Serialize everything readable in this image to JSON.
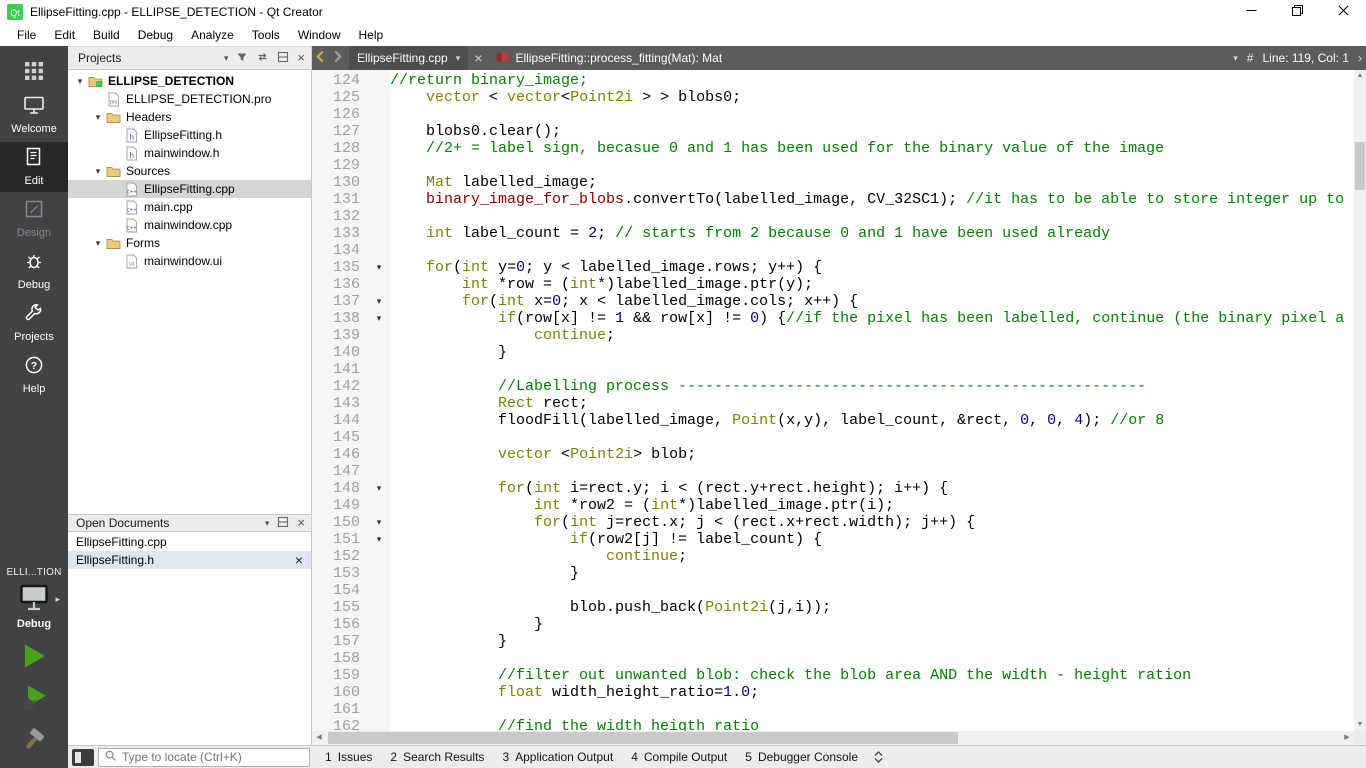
{
  "window": {
    "title": "EllipseFitting.cpp - ELLIPSE_DETECTION - Qt Creator"
  },
  "menu": {
    "items": [
      "File",
      "Edit",
      "Build",
      "Debug",
      "Analyze",
      "Tools",
      "Window",
      "Help"
    ]
  },
  "modes": {
    "items": [
      {
        "label": "Welcome",
        "icon": "welcome-icon",
        "state": "normal"
      },
      {
        "label": "Edit",
        "icon": "edit-icon",
        "state": "active"
      },
      {
        "label": "Design",
        "icon": "design-icon",
        "state": "disabled"
      },
      {
        "label": "Debug",
        "icon": "debug-icon",
        "state": "normal"
      },
      {
        "label": "Projects",
        "icon": "projects-icon",
        "state": "normal"
      },
      {
        "label": "Help",
        "icon": "help-icon",
        "state": "normal"
      }
    ],
    "kit": {
      "name": "ELLI...TION",
      "config": "Debug"
    }
  },
  "projects_panel": {
    "header": "Projects",
    "tree": [
      {
        "depth": 0,
        "expanded": true,
        "icon": "project",
        "label": "ELLIPSE_DETECTION",
        "bold": true
      },
      {
        "depth": 1,
        "icon": "pro",
        "label": "ELLIPSE_DETECTION.pro"
      },
      {
        "depth": 1,
        "expanded": true,
        "icon": "folder",
        "label": "Headers"
      },
      {
        "depth": 2,
        "icon": "h",
        "label": "EllipseFitting.h"
      },
      {
        "depth": 2,
        "icon": "h",
        "label": "mainwindow.h"
      },
      {
        "depth": 1,
        "expanded": true,
        "icon": "folder",
        "label": "Sources"
      },
      {
        "depth": 2,
        "icon": "cpp",
        "label": "EllipseFitting.cpp",
        "selected": true
      },
      {
        "depth": 2,
        "icon": "cpp",
        "label": "main.cpp"
      },
      {
        "depth": 2,
        "icon": "cpp",
        "label": "mainwindow.cpp"
      },
      {
        "depth": 1,
        "expanded": true,
        "icon": "folder",
        "label": "Forms"
      },
      {
        "depth": 2,
        "icon": "ui",
        "label": "mainwindow.ui"
      }
    ]
  },
  "open_documents": {
    "header": "Open Documents",
    "items": [
      {
        "label": "EllipseFitting.cpp",
        "selected": false,
        "closable": false
      },
      {
        "label": "EllipseFitting.h",
        "selected": true,
        "closable": true
      }
    ]
  },
  "editor": {
    "tab_label": "EllipseFitting.cpp",
    "symbol_label": "EllipseFitting::process_fitting(Mat): Mat",
    "hash_label": "#",
    "cursor_label": "Line: 119, Col: 1",
    "lines": [
      {
        "n": 124,
        "t": [
          [
            "cm",
            "//return binary_image;"
          ]
        ]
      },
      {
        "n": 125,
        "t": [
          [
            "pl",
            "    "
          ],
          [
            "kw",
            "vector"
          ],
          [
            "pl",
            " < "
          ],
          [
            "kw",
            "vector"
          ],
          [
            "pl",
            "<"
          ],
          [
            "kw",
            "Point2i"
          ],
          [
            "pl",
            " > > blobs0;"
          ]
        ]
      },
      {
        "n": 126,
        "t": []
      },
      {
        "n": 127,
        "t": [
          [
            "pl",
            "    blobs0.clear();"
          ]
        ]
      },
      {
        "n": 128,
        "t": [
          [
            "pl",
            "    "
          ],
          [
            "cm",
            "//2+ = label sign, becasue 0 and 1 has been used for the binary value of the image"
          ]
        ]
      },
      {
        "n": 129,
        "t": []
      },
      {
        "n": 130,
        "t": [
          [
            "pl",
            "    "
          ],
          [
            "kw",
            "Mat"
          ],
          [
            "pl",
            " labelled_image;"
          ]
        ]
      },
      {
        "n": 131,
        "t": [
          [
            "pl",
            "    "
          ],
          [
            "fd",
            "binary_image_for_blobs"
          ],
          [
            "pl",
            ".convertTo(labelled_image, CV_32SC1); "
          ],
          [
            "cm",
            "//it has to be able to store integer up to"
          ]
        ]
      },
      {
        "n": 132,
        "t": []
      },
      {
        "n": 133,
        "t": [
          [
            "pl",
            "    "
          ],
          [
            "kw",
            "int"
          ],
          [
            "pl",
            " label_count = "
          ],
          [
            "nu",
            "2"
          ],
          [
            "pl",
            "; "
          ],
          [
            "cm",
            "// starts from 2 because 0 and 1 have been used already"
          ]
        ]
      },
      {
        "n": 134,
        "t": []
      },
      {
        "n": 135,
        "fold": true,
        "t": [
          [
            "pl",
            "    "
          ],
          [
            "kw",
            "for"
          ],
          [
            "pl",
            "("
          ],
          [
            "kw",
            "int"
          ],
          [
            "pl",
            " y="
          ],
          [
            "nu",
            "0"
          ],
          [
            "pl",
            "; y < labelled_image.rows; y++) {"
          ]
        ]
      },
      {
        "n": 136,
        "t": [
          [
            "pl",
            "        "
          ],
          [
            "kw",
            "int"
          ],
          [
            "pl",
            " *row = ("
          ],
          [
            "kw",
            "int"
          ],
          [
            "pl",
            "*)labelled_image.ptr(y);"
          ]
        ]
      },
      {
        "n": 137,
        "fold": true,
        "t": [
          [
            "pl",
            "        "
          ],
          [
            "kw",
            "for"
          ],
          [
            "pl",
            "("
          ],
          [
            "kw",
            "int"
          ],
          [
            "pl",
            " x="
          ],
          [
            "nu",
            "0"
          ],
          [
            "pl",
            "; x < labelled_image.cols; x++) {"
          ]
        ]
      },
      {
        "n": 138,
        "fold": true,
        "t": [
          [
            "pl",
            "            "
          ],
          [
            "kw",
            "if"
          ],
          [
            "pl",
            "(row[x] != "
          ],
          [
            "nu",
            "1"
          ],
          [
            "pl",
            " && row[x] != "
          ],
          [
            "nu",
            "0"
          ],
          [
            "pl",
            ") {"
          ],
          [
            "cm",
            "//if the pixel has been labelled, continue (the binary pixel a"
          ]
        ]
      },
      {
        "n": 139,
        "t": [
          [
            "pl",
            "                "
          ],
          [
            "kw",
            "continue"
          ],
          [
            "pl",
            ";"
          ]
        ]
      },
      {
        "n": 140,
        "t": [
          [
            "pl",
            "            }"
          ]
        ]
      },
      {
        "n": 141,
        "t": []
      },
      {
        "n": 142,
        "t": [
          [
            "pl",
            "            "
          ],
          [
            "cm",
            "//Labelling process ----------------------------------------------------"
          ]
        ]
      },
      {
        "n": 143,
        "t": [
          [
            "pl",
            "            "
          ],
          [
            "kw",
            "Rect"
          ],
          [
            "pl",
            " rect;"
          ]
        ]
      },
      {
        "n": 144,
        "t": [
          [
            "pl",
            "            floodFill(labelled_image, "
          ],
          [
            "kw",
            "Point"
          ],
          [
            "pl",
            "(x,y), label_count, &rect, "
          ],
          [
            "nu",
            "0"
          ],
          [
            "pl",
            ", "
          ],
          [
            "nu",
            "0"
          ],
          [
            "pl",
            ", "
          ],
          [
            "nu",
            "4"
          ],
          [
            "pl",
            "); "
          ],
          [
            "cm",
            "//or 8"
          ]
        ]
      },
      {
        "n": 145,
        "t": []
      },
      {
        "n": 146,
        "t": [
          [
            "pl",
            "            "
          ],
          [
            "kw",
            "vector"
          ],
          [
            "pl",
            " <"
          ],
          [
            "kw",
            "Point2i"
          ],
          [
            "pl",
            "> blob;"
          ]
        ]
      },
      {
        "n": 147,
        "t": []
      },
      {
        "n": 148,
        "fold": true,
        "t": [
          [
            "pl",
            "            "
          ],
          [
            "kw",
            "for"
          ],
          [
            "pl",
            "("
          ],
          [
            "kw",
            "int"
          ],
          [
            "pl",
            " i=rect.y; i < (rect.y+rect.height); i++) {"
          ]
        ]
      },
      {
        "n": 149,
        "t": [
          [
            "pl",
            "                "
          ],
          [
            "kw",
            "int"
          ],
          [
            "pl",
            " *row2 = ("
          ],
          [
            "kw",
            "int"
          ],
          [
            "pl",
            "*)labelled_image.ptr(i);"
          ]
        ]
      },
      {
        "n": 150,
        "fold": true,
        "t": [
          [
            "pl",
            "                "
          ],
          [
            "kw",
            "for"
          ],
          [
            "pl",
            "("
          ],
          [
            "kw",
            "int"
          ],
          [
            "pl",
            " j=rect.x; j < (rect.x+rect.width); j++) {"
          ]
        ]
      },
      {
        "n": 151,
        "fold": true,
        "t": [
          [
            "pl",
            "                    "
          ],
          [
            "kw",
            "if"
          ],
          [
            "pl",
            "(row2[j] != label_count) {"
          ]
        ]
      },
      {
        "n": 152,
        "t": [
          [
            "pl",
            "                        "
          ],
          [
            "kw",
            "continue"
          ],
          [
            "pl",
            ";"
          ]
        ]
      },
      {
        "n": 153,
        "t": [
          [
            "pl",
            "                    }"
          ]
        ]
      },
      {
        "n": 154,
        "t": []
      },
      {
        "n": 155,
        "t": [
          [
            "pl",
            "                    blob.push_back("
          ],
          [
            "kw",
            "Point2i"
          ],
          [
            "pl",
            "(j,i));"
          ]
        ]
      },
      {
        "n": 156,
        "t": [
          [
            "pl",
            "                }"
          ]
        ]
      },
      {
        "n": 157,
        "t": [
          [
            "pl",
            "            }"
          ]
        ]
      },
      {
        "n": 158,
        "t": []
      },
      {
        "n": 159,
        "t": [
          [
            "pl",
            "            "
          ],
          [
            "cm",
            "//filter out unwanted blob: check the blob area AND the width - height ration"
          ]
        ]
      },
      {
        "n": 160,
        "t": [
          [
            "pl",
            "            "
          ],
          [
            "kw",
            "float"
          ],
          [
            "pl",
            " width_height_ratio="
          ],
          [
            "nu",
            "1.0"
          ],
          [
            "pl",
            ";"
          ]
        ]
      },
      {
        "n": 161,
        "t": []
      },
      {
        "n": 162,
        "t": [
          [
            "pl",
            "            "
          ],
          [
            "cm",
            "//find the width heigth ratio"
          ]
        ]
      }
    ]
  },
  "statusbar": {
    "locator_placeholder": "Type to locate (Ctrl+K)",
    "panes": [
      {
        "key": "1",
        "label": "Issues"
      },
      {
        "key": "2",
        "label": "Search Results"
      },
      {
        "key": "3",
        "label": "Application Output"
      },
      {
        "key": "4",
        "label": "Compile Output"
      },
      {
        "key": "5",
        "label": "Debugger Console"
      }
    ]
  },
  "colors": {
    "keyword": "#808000",
    "comment": "#008000",
    "number": "#000080",
    "field": "#800000",
    "run_green": "#47a11c",
    "sidebar_bg": "#404244"
  }
}
